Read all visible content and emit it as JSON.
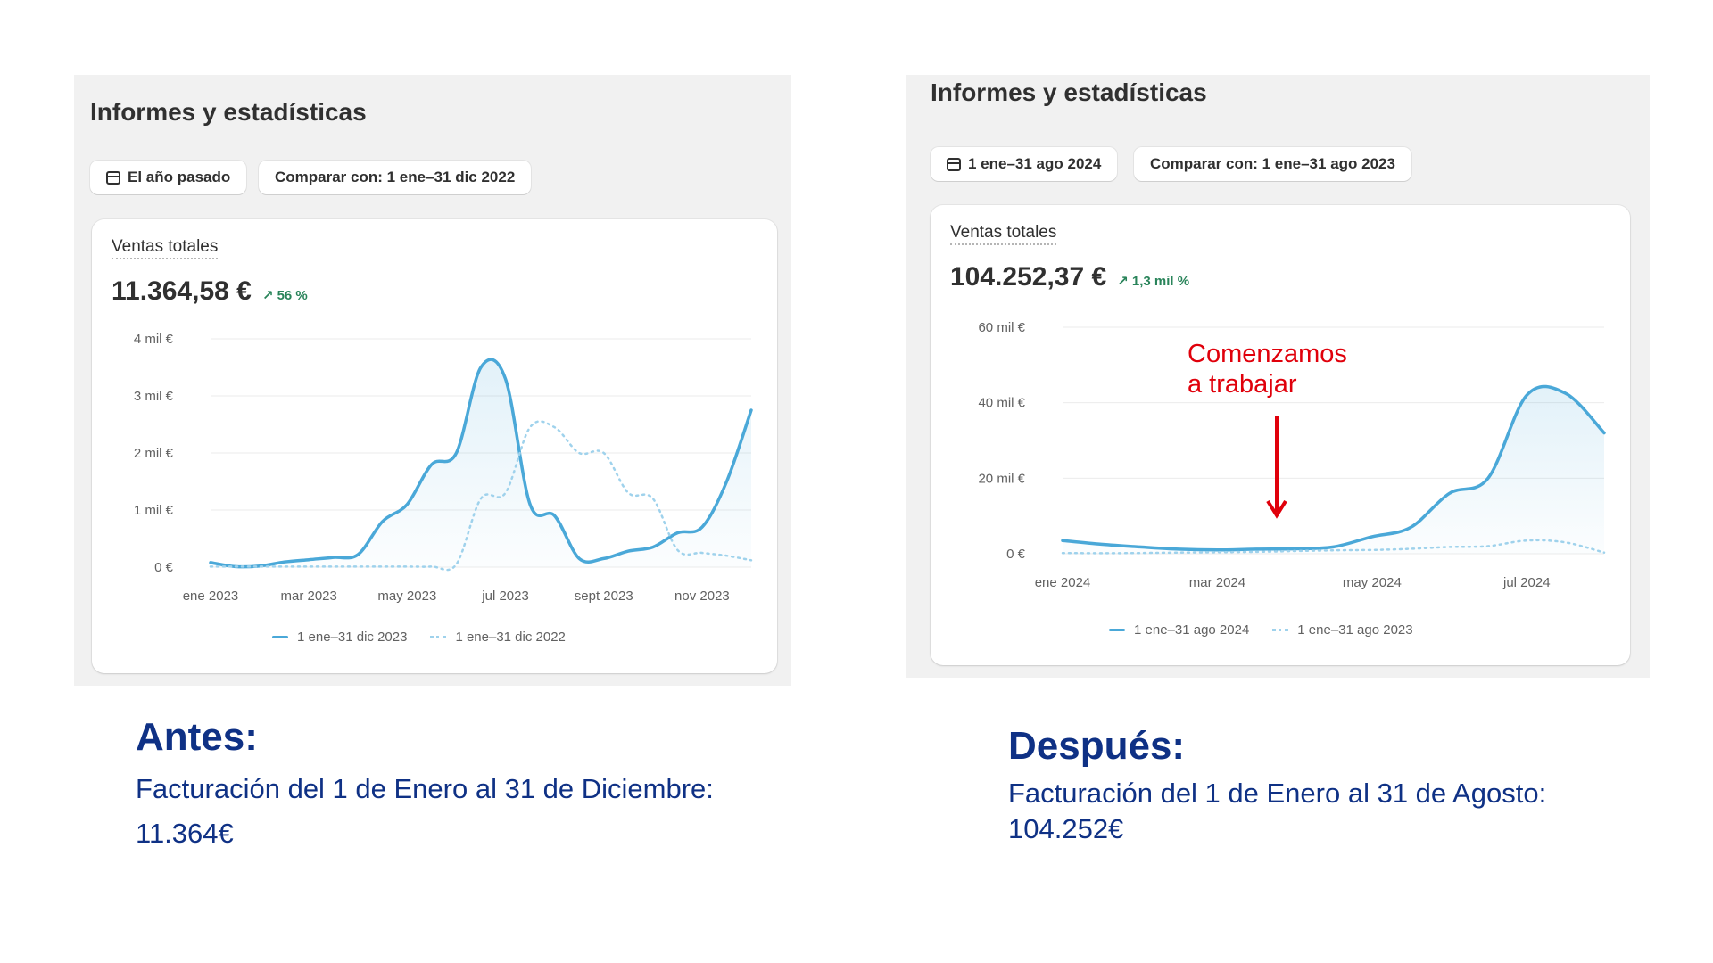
{
  "before": {
    "title": "Informes y estadísticas",
    "date_pill": "El año pasado",
    "compare_pill": "Comparar con: 1 ene–31 dic 2022",
    "metric_label": "Ventas totales",
    "metric_value": "11.364,58 €",
    "metric_change": "↗ 56 %",
    "legend": [
      "1 ene–31 dic 2023",
      "1 ene–31 dic 2022"
    ],
    "caption_head": "Antes:",
    "caption_line1": "Facturación del 1 de Enero al 31 de Diciembre:",
    "caption_line2": "11.364€"
  },
  "after": {
    "title": "Informes y estadísticas",
    "date_pill": "1 ene–31 ago 2024",
    "compare_pill": "Comparar con: 1 ene–31 ago 2023",
    "metric_label": "Ventas totales",
    "metric_value": "104.252,37 €",
    "metric_change": "↗ 1,3 mil %",
    "legend": [
      "1 ene–31 ago 2024",
      "1 ene–31 ago 2023"
    ],
    "annotation_line1": "Comenzamos",
    "annotation_line2": "a trabajar",
    "caption_head": "Después:",
    "caption_line1": "Facturación del 1 de Enero al 31 de Agosto:",
    "caption_line2": "104.252€"
  },
  "colors": {
    "current": "#4aa8d8",
    "previous": "#9fd2ec",
    "annotation": "#e0000b",
    "caption": "#0f3185",
    "positive": "#29845a"
  },
  "chart_data": [
    {
      "type": "line",
      "xlabel": "",
      "ylabel": "",
      "x_ticks": [
        "ene 2023",
        "mar 2023",
        "may 2023",
        "jul 2023",
        "sept 2023",
        "nov 2023"
      ],
      "y_ticks": [
        "0 €",
        "1 mil €",
        "2 mil €",
        "3 mil €",
        "4 mil €"
      ],
      "ylim": [
        0,
        4000
      ],
      "xlim": [
        0,
        11
      ],
      "grid": true,
      "legend_position": "bottom",
      "series": [
        {
          "name": "1 ene–31 dic 2023",
          "style": "solid",
          "x": [
            0,
            0.5,
            1,
            1.5,
            2,
            2.5,
            3,
            3.5,
            4,
            4.5,
            5,
            5.5,
            6,
            6.5,
            7,
            7.5,
            8,
            8.5,
            9,
            9.5,
            10,
            10.5,
            11
          ],
          "y": [
            80,
            10,
            20,
            90,
            130,
            170,
            220,
            800,
            1100,
            1800,
            2000,
            3500,
            3300,
            1100,
            900,
            150,
            150,
            280,
            350,
            600,
            700,
            1500,
            2750
          ]
        },
        {
          "name": "1 ene–31 dic 2022",
          "style": "dotted",
          "x": [
            0,
            0.5,
            1,
            1.5,
            2,
            2.5,
            3,
            3.5,
            4,
            4.5,
            5,
            5.5,
            6,
            6.5,
            7,
            7.5,
            8,
            8.5,
            9,
            9.5,
            10,
            10.5,
            11
          ],
          "y": [
            10,
            10,
            10,
            10,
            10,
            10,
            10,
            10,
            10,
            10,
            50,
            1200,
            1300,
            2450,
            2450,
            2000,
            2000,
            1300,
            1200,
            300,
            250,
            200,
            120
          ]
        }
      ]
    },
    {
      "type": "line",
      "xlabel": "",
      "ylabel": "",
      "x_ticks": [
        "ene 2024",
        "mar 2024",
        "may 2024",
        "jul 2024"
      ],
      "y_ticks": [
        "0 €",
        "20 mil €",
        "40 mil €",
        "60 mil €"
      ],
      "ylim": [
        0,
        60000
      ],
      "xlim": [
        0,
        7
      ],
      "grid": true,
      "legend_position": "bottom",
      "series": [
        {
          "name": "1 ene–31 ago 2024",
          "style": "solid",
          "x": [
            0,
            0.5,
            1,
            1.5,
            2,
            2.5,
            3,
            3.5,
            4,
            4.5,
            5,
            5.5,
            6,
            6.5,
            7
          ],
          "y": [
            3500,
            2500,
            1800,
            1200,
            1000,
            1200,
            1300,
            1800,
            4500,
            7000,
            16000,
            20000,
            42000,
            42500,
            32000
          ]
        },
        {
          "name": "1 ene–31 ago 2023",
          "style": "dotted",
          "x": [
            0,
            0.5,
            1,
            1.5,
            2,
            2.5,
            3,
            3.5,
            4,
            4.5,
            5,
            5.5,
            6,
            6.5,
            7
          ],
          "y": [
            200,
            150,
            200,
            300,
            400,
            500,
            700,
            900,
            1000,
            1300,
            1800,
            2000,
            3500,
            3000,
            300
          ]
        }
      ]
    }
  ]
}
